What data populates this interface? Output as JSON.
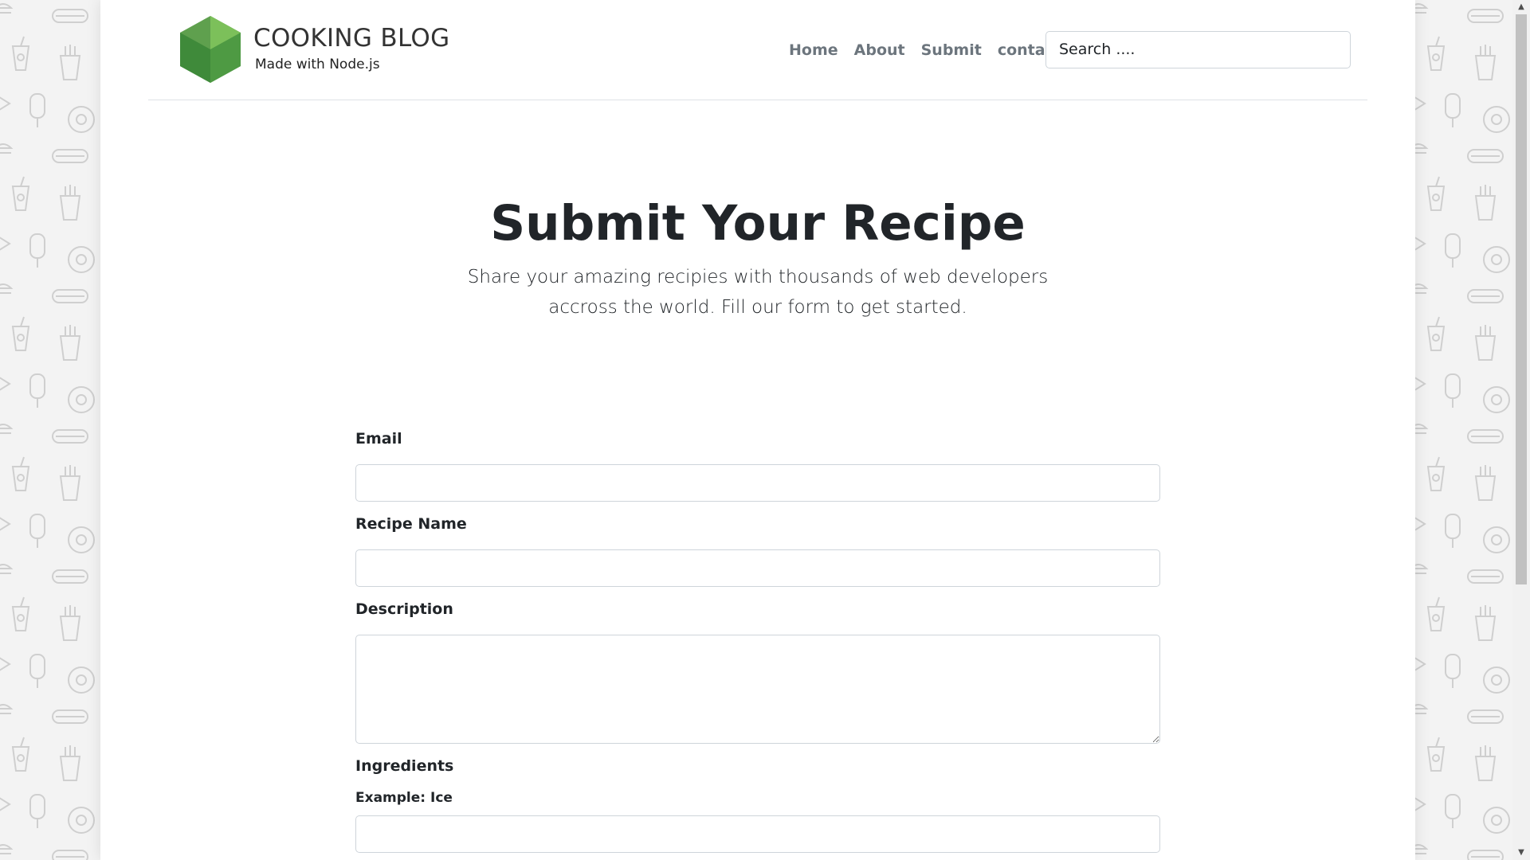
{
  "brand": {
    "title": "COOKING BLOG",
    "subtitle": "Made with Node.js",
    "logo_icon": "nodejs-hexagon-icon"
  },
  "nav": {
    "items": [
      {
        "label": "Home"
      },
      {
        "label": "About"
      },
      {
        "label": "Submit"
      },
      {
        "label": "contact"
      }
    ]
  },
  "search": {
    "placeholder": "Search ...."
  },
  "hero": {
    "title": "Submit Your Recipe",
    "lead": "Share your amazing recipies with thousands of web developers accross the world. Fill our form to get started."
  },
  "form": {
    "email_label": "Email",
    "email_value": "",
    "recipe_name_label": "Recipe Name",
    "recipe_name_value": "",
    "description_label": "Description",
    "description_value": "",
    "ingredients_label": "Ingredients",
    "ingredients_help": "Example: Ice",
    "ingredient_value": ""
  },
  "colors": {
    "accent_green": "#5fa04e",
    "nav_text": "#6c757d",
    "heading": "#212529"
  }
}
